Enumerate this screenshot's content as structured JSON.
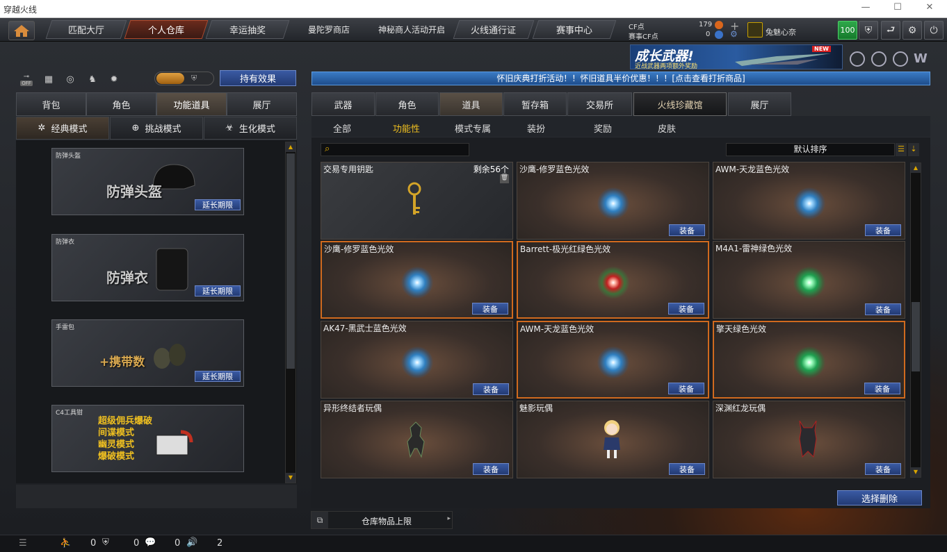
{
  "window": {
    "title": "穿越火线"
  },
  "nav": {
    "tabs": [
      "匹配大厅",
      "个人仓库",
      "幸运抽奖",
      "曼陀罗商店",
      "神秘商人活动开启",
      "火线通行证",
      "赛事中心"
    ]
  },
  "account": {
    "cf_label": "CF点",
    "cf_value": "179",
    "match_cf_label": "赛事CF点",
    "match_cf_value": "0",
    "username": "兔魅心奈",
    "level_badge": "100"
  },
  "ad": {
    "title": "成长武器!",
    "subtitle": "近战武器两项额外奖励",
    "badge": "NEW"
  },
  "left": {
    "off_label": "OFF",
    "effect_button": "持有效果",
    "tabs": [
      "背包",
      "角色",
      "功能道具",
      "展厅"
    ],
    "modes": [
      "经典模式",
      "挑战模式",
      "生化模式"
    ],
    "cards": [
      {
        "label": "防弹头盔",
        "title": "防弹头盔",
        "extend": "延长期限"
      },
      {
        "label": "防弹衣",
        "title": "防弹衣",
        "extend": "延长期限"
      },
      {
        "label": "手雷包",
        "title": "+携带数",
        "extend": "延长期限"
      },
      {
        "label": "C4工具钳",
        "lines": [
          "超级佣兵爆破",
          "间谍模式",
          "幽灵模式",
          "爆破模式"
        ]
      }
    ]
  },
  "right": {
    "notice": "怀旧庆典打折活动！！怀旧道具半价优惠！！！[点击查看打折商品]",
    "tabs": [
      "武器",
      "角色",
      "道具",
      "暂存箱",
      "交易所",
      "火线珍藏馆",
      "展厅"
    ],
    "filters": [
      "全部",
      "功能性",
      "模式专属",
      "装扮",
      "奖励",
      "皮肤"
    ],
    "search_placeholder": "",
    "sort_label": "默认排序",
    "items": [
      {
        "name": "交易专用钥匙",
        "count": "剩余56个"
      },
      {
        "name": "沙鹰-修罗蓝色光效",
        "equip": "装备"
      },
      {
        "name": "AWM-天龙蓝色光效",
        "equip": "装备"
      },
      {
        "name": "沙鹰-修罗蓝色光效",
        "equip": "装备"
      },
      {
        "name": "Barrett-极光红绿色光效",
        "equip": "装备"
      },
      {
        "name": "M4A1-雷神绿色光效",
        "equip": "装备"
      },
      {
        "name": "AK47-黑武士蓝色光效",
        "equip": "装备"
      },
      {
        "name": "AWM-天龙蓝色光效",
        "equip": "装备"
      },
      {
        "name": "擎天绿色光效",
        "equip": "装备"
      },
      {
        "name": "异形终结者玩偶",
        "equip": "装备"
      },
      {
        "name": "魅影玩偶",
        "equip": "装备"
      },
      {
        "name": "深渊红龙玩偶",
        "equip": "装备"
      }
    ],
    "delete_button": "选择删除",
    "capacity_label": "仓库物品上限"
  },
  "statusbar": {
    "values": [
      "0",
      "0",
      "0",
      "2"
    ]
  }
}
